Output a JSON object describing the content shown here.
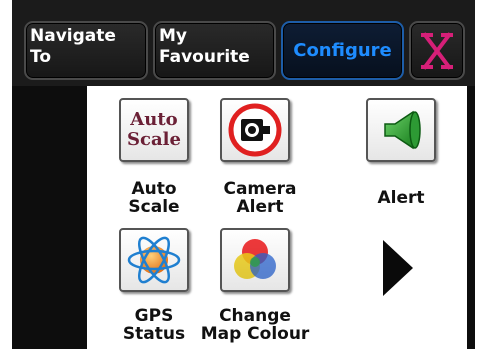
{
  "tabs": [
    {
      "id": "navigate",
      "line1": "Navigate",
      "line2": "To"
    },
    {
      "id": "favourite",
      "line1": "My",
      "line2": "Favourite"
    },
    {
      "id": "configure",
      "label": "Configure",
      "active": true
    }
  ],
  "close_icon": "close-x-icon",
  "items": {
    "auto_scale": {
      "label_line1": "Auto",
      "label_line2": "Scale",
      "icon_text_line1": "Auto",
      "icon_text_line2": "Scale"
    },
    "camera_alert": {
      "label_line1": "Camera",
      "label_line2": "Alert",
      "icon": "speed-camera-icon"
    },
    "alert": {
      "label_line1": "Alert",
      "icon": "speaker-icon"
    },
    "gps_status": {
      "label_line1": "GPS",
      "label_line2": "Status",
      "icon": "satellite-globe-icon"
    },
    "map_colour": {
      "label_line1": "Change",
      "label_line2": "Map Colour",
      "icon": "color-circles-icon"
    }
  },
  "next_arrow_icon": "next-page-arrow-icon",
  "colors": {
    "active_tab": "#1e8cff",
    "close_x": "#d61f78",
    "frame": "#0d0d0d"
  }
}
